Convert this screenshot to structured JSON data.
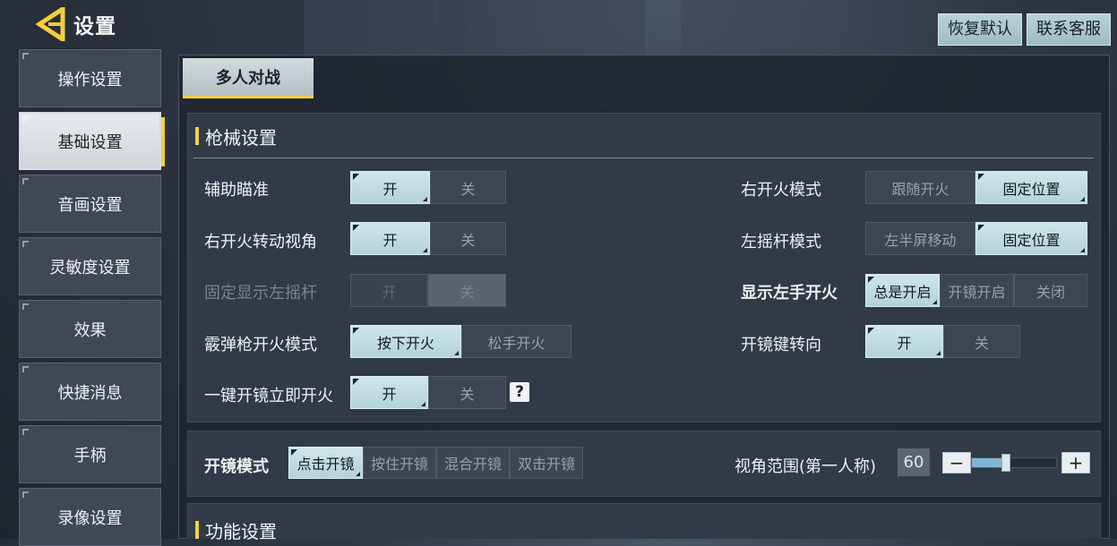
{
  "header": {
    "title": "设置",
    "restore_default": "恢复默认",
    "contact_support": "联系客服"
  },
  "sidebar": {
    "items": [
      {
        "label": "操作设置"
      },
      {
        "label": "基础设置"
      },
      {
        "label": "音画设置"
      },
      {
        "label": "灵敏度设置"
      },
      {
        "label": "效果"
      },
      {
        "label": "快捷消息"
      },
      {
        "label": "手柄"
      },
      {
        "label": "录像设置"
      }
    ],
    "active_index": 1
  },
  "tabs": [
    {
      "label": "多人对战"
    }
  ],
  "weapon_section": {
    "title": "枪械设置",
    "rows_left": [
      {
        "label": "辅助瞄准",
        "options": [
          "开",
          "关"
        ],
        "selected": "开"
      },
      {
        "label": "右开火转动视角",
        "options": [
          "开",
          "关"
        ],
        "selected": "开"
      },
      {
        "label": "固定显示左摇杆",
        "options": [
          "开",
          "关"
        ],
        "selected": "关",
        "disabled": true
      },
      {
        "label": "霰弹枪开火模式",
        "options": [
          "按下开火",
          "松手开火"
        ],
        "selected": "按下开火"
      },
      {
        "label": "一键开镜立即开火",
        "options": [
          "开",
          "关"
        ],
        "selected": "开"
      }
    ],
    "rows_right": [
      {
        "label": "右开火模式",
        "options": [
          "跟随开火",
          "固定位置"
        ],
        "selected": "固定位置"
      },
      {
        "label": "左摇杆模式",
        "options": [
          "左半屏移动",
          "固定位置"
        ],
        "selected": "固定位置"
      },
      {
        "label": "显示左手开火",
        "options": [
          "总是开启",
          "开镜开启",
          "关闭"
        ],
        "selected": "总是开启"
      },
      {
        "label": "开镜键转向",
        "options": [
          "开",
          "关"
        ],
        "selected": "开"
      }
    ],
    "help_icon": "?"
  },
  "scope_section": {
    "label": "开镜模式",
    "options": [
      "点击开镜",
      "按住开镜",
      "混合开镜",
      "双击开镜"
    ],
    "selected": "点击开镜",
    "fov_label": "视角范围(第一人称)",
    "fov_value": "60",
    "fov_slider_fraction": 0.4,
    "minus": "−",
    "plus": "+"
  },
  "function_section": {
    "title": "功能设置"
  },
  "colors": {
    "accent": "#f5cf3b",
    "selected": "#c2dfe3"
  }
}
